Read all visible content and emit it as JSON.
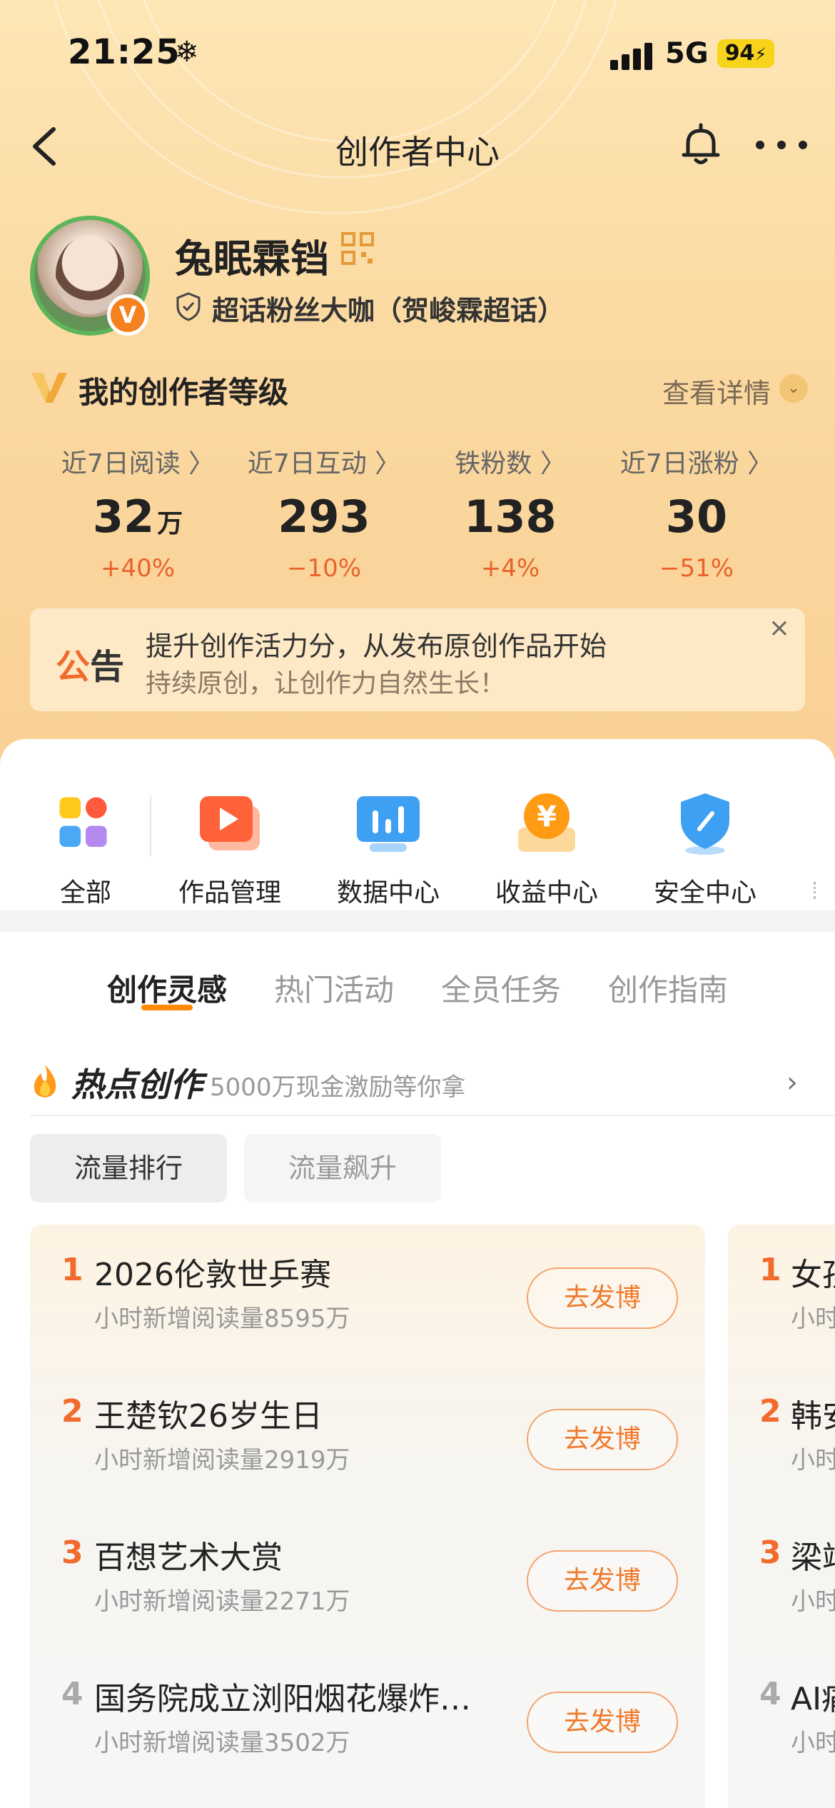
{
  "status_bar": {
    "time": "21:25",
    "weather_glyph": "❄",
    "network": "5G",
    "battery": "94"
  },
  "nav": {
    "title": "创作者中心"
  },
  "profile": {
    "username": "兔眠霖铛",
    "badge": "超话粉丝大咖（贺峻霖超话）",
    "verified": "V"
  },
  "level": {
    "title": "我的创作者等级",
    "detail": "查看详情"
  },
  "stats": [
    {
      "label": "近7日阅读 〉",
      "value": "32",
      "unit": "万",
      "change": "+40%"
    },
    {
      "label": "近7日互动 〉",
      "value": "293",
      "unit": "",
      "change": "−10%"
    },
    {
      "label": "铁粉数 〉",
      "value": "138",
      "unit": "",
      "change": "+4%"
    },
    {
      "label": "近7日涨粉 〉",
      "value": "30",
      "unit": "",
      "change": "−51%"
    }
  ],
  "notice": {
    "tag_first": "公",
    "tag_second": "告",
    "title": "提升创作活力分，从发布原创作品开始",
    "subtitle": "持续原创，让创作力自然生长！",
    "close": "×"
  },
  "shortcuts": [
    {
      "label": "全部",
      "icon": "grid-icon"
    },
    {
      "label": "作品管理",
      "icon": "play-icon"
    },
    {
      "label": "数据中心",
      "icon": "chart-icon"
    },
    {
      "label": "收益中心",
      "icon": "yen-icon"
    },
    {
      "label": "安全中心",
      "icon": "shield-icon"
    }
  ],
  "tabs": [
    "创作灵感",
    "热门活动",
    "全员任务",
    "创作指南"
  ],
  "hot": {
    "title": "热点创作",
    "subtitle": "5000万现金激励等你拿",
    "chevron": "›"
  },
  "filters": [
    "流量排行",
    "流量飙升"
  ],
  "rank_list": [
    {
      "rank": "1",
      "title": "2026伦敦世乒赛",
      "sub": "小时新增阅读量8595万",
      "button": "去发博"
    },
    {
      "rank": "2",
      "title": "王楚钦26岁生日",
      "sub": "小时新增阅读量2919万",
      "button": "去发博"
    },
    {
      "rank": "3",
      "title": "百想艺术大赏",
      "sub": "小时新增阅读量2271万",
      "button": "去发博"
    },
    {
      "rank": "4",
      "title": "国务院成立浏阳烟花爆炸…",
      "sub": "小时新增阅读量3502万",
      "button": "去发博"
    }
  ],
  "rank_list_2": [
    {
      "rank": "1",
      "title": "女孩",
      "sub": "小时"
    },
    {
      "rank": "2",
      "title": "韩安",
      "sub": "小时"
    },
    {
      "rank": "3",
      "title": "梁靖",
      "sub": "小时"
    },
    {
      "rank": "4",
      "title": "AI痛",
      "sub": "小时"
    }
  ],
  "colors": {
    "accent": "#f06b2c",
    "header_bg": "#fbd9a0",
    "tab_underline": "#ff8a00"
  }
}
